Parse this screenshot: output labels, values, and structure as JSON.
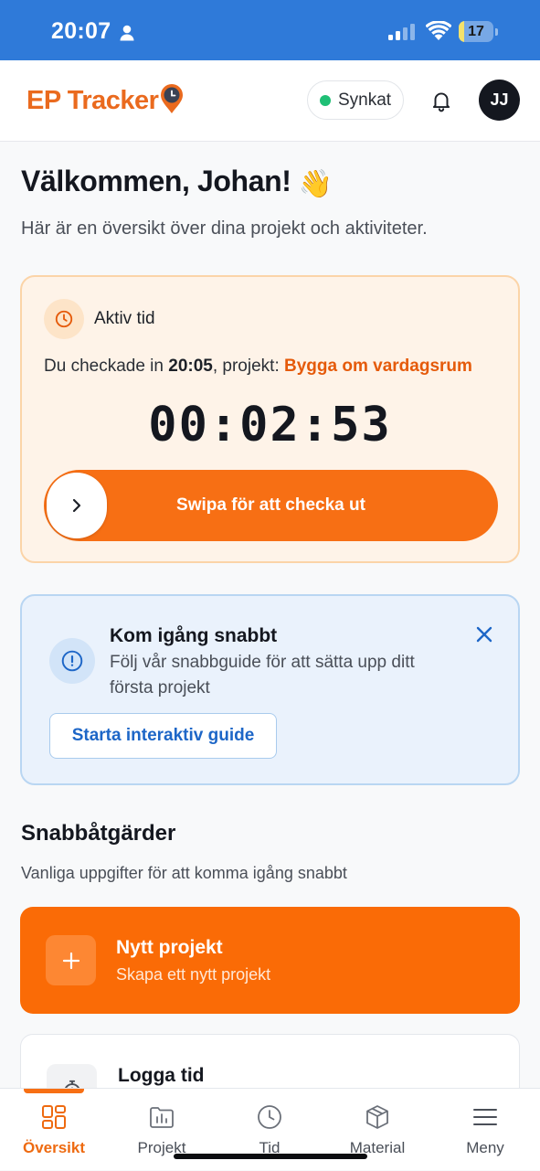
{
  "status_bar": {
    "time": "20:07",
    "battery": "17",
    "battery_level": 0.17
  },
  "header": {
    "logo": "EP Tracker",
    "sync_label": "Synkat",
    "avatar_initials": "JJ"
  },
  "welcome": {
    "title": "Välkommen, Johan!",
    "emoji": "👋",
    "subtitle": "Här är en översikt över dina projekt och aktiviteter."
  },
  "active_time": {
    "label": "Aktiv tid",
    "checked_in_prefix": "Du checkade in ",
    "checked_in_time": "20:05",
    "project_prefix": ", projekt: ",
    "project_name": "Bygga om vardagsrum",
    "timer": "00:02:53",
    "swipe_label": "Swipa för att checka ut"
  },
  "guide": {
    "title": "Kom igång snabbt",
    "description": "Följ vår snabbguide för att sätta upp ditt första projekt",
    "button": "Starta interaktiv guide"
  },
  "quick_actions": {
    "title": "Snabbåtgärder",
    "subtitle": "Vanliga uppgifter för att komma igång snabbt",
    "new_project": {
      "title": "Nytt projekt",
      "subtitle": "Skapa ett nytt projekt",
      "icon": "plus-icon"
    },
    "log_time": {
      "title": "Logga tid",
      "icon": "stopwatch-icon"
    }
  },
  "nav": {
    "items": [
      {
        "label": "Översikt",
        "icon": "dashboard-icon",
        "active": true
      },
      {
        "label": "Projekt",
        "icon": "project-chart-icon",
        "active": false
      },
      {
        "label": "Tid",
        "icon": "clock-icon",
        "active": false
      },
      {
        "label": "Material",
        "icon": "box-icon",
        "active": false
      },
      {
        "label": "Meny",
        "icon": "menu-icon",
        "active": false
      }
    ]
  },
  "colors": {
    "brand_orange": "#f76f14",
    "status_bar_blue": "#2f7ad9",
    "sync_green": "#1fbf75",
    "guide_blue": "#1d66c7"
  }
}
